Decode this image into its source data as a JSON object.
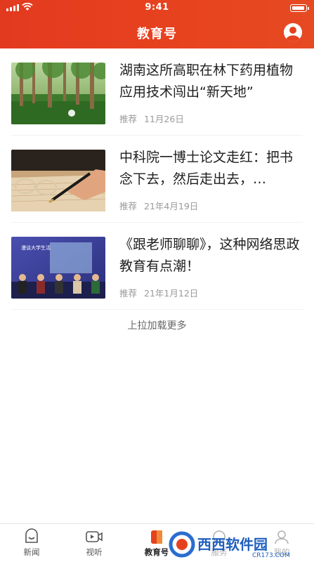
{
  "status_bar": {
    "time": "9:41"
  },
  "header": {
    "title": "教育号"
  },
  "articles": [
    {
      "title": "湖南这所高职在林下药用植物应用技术闯出“新天地”",
      "tag": "推荐",
      "date": "11月26日"
    },
    {
      "title": "中科院一博士论文走红：把书念下去，然后走出去，…",
      "tag": "推荐",
      "date": "21年4月19日"
    },
    {
      "title": "《跟老师聊聊》，这种网络思政教育有点潮！",
      "tag": "推荐",
      "date": "21年1月12日"
    }
  ],
  "load_more": "上拉加载更多",
  "tabs": [
    {
      "label": "新闻",
      "icon": "news-icon"
    },
    {
      "label": "视听",
      "icon": "video-icon"
    },
    {
      "label": "教育号",
      "icon": "education-icon",
      "active": true
    },
    {
      "label": "服务",
      "icon": "service-icon"
    },
    {
      "label": "我的",
      "icon": "profile-icon"
    }
  ],
  "thumb_caption_3": "漫谈大学生活",
  "watermark": {
    "brand": "西西软件园",
    "url": "CR173.COM"
  },
  "colors": {
    "header": "#e6411f",
    "text": "#1e1e1e",
    "meta": "#9a9a9a"
  }
}
